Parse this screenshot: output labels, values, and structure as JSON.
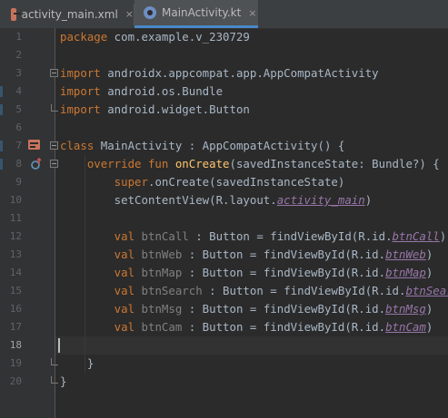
{
  "tabs": [
    {
      "label": "activity_main.xml",
      "icon": "xml-file-icon",
      "close": "×"
    },
    {
      "label": "MainActivity.kt",
      "icon": "kotlin-file-icon",
      "close": "×"
    }
  ],
  "line_numbers": [
    "1",
    "2",
    "3",
    "4",
    "5",
    "6",
    "7",
    "8",
    "9",
    "10",
    "11",
    "12",
    "13",
    "14",
    "15",
    "16",
    "17",
    "18",
    "19",
    "20"
  ],
  "code": {
    "l1_kw": "package",
    "l1_rest": " com.example.v_230729",
    "l3_kw": "import",
    "l3_rest": " androidx.appcompat.app.AppCompatActivity",
    "l4_kw": "import",
    "l4_rest": " android.os.Bundle",
    "l5_kw": "import",
    "l5_rest": " android.widget.Button",
    "l7_kw": "class",
    "l7_rest": " MainActivity : AppCompatActivity() {",
    "l8_kw": "    override fun ",
    "l8_fn": "onCreate",
    "l8_rest": "(savedInstanceState: Bundle?) {",
    "l9_kw": "        super",
    "l9_rest": ".onCreate(savedInstanceState)",
    "l10_pre": "        setContentView(R.layout.",
    "l10_prop": "activity_main",
    "l10_post": ")",
    "vals": [
      {
        "name": "btnCall",
        "pad": " : Button = findViewById(R.id.",
        "ref": "btnCall",
        "post": ")"
      },
      {
        "name": "btnWeb",
        "pad": " : Button = findViewById(R.id.",
        "ref": "btnWeb",
        "post": ")"
      },
      {
        "name": "btnMap",
        "pad": " : Button = findViewById(R.id.",
        "ref": "btnMap",
        "post": ")"
      },
      {
        "name": "btnSearch",
        "pad": " : Button = findViewById(R.id.",
        "ref": "btnSearch",
        "post": ")"
      },
      {
        "name": "btnMsg",
        "pad": " : Button = findViewById(R.id.",
        "ref": "btnMsg",
        "post": ")"
      },
      {
        "name": "btnCam",
        "pad": " : Button = findViewById(R.id.",
        "ref": "btnCam",
        "post": ")"
      }
    ],
    "val_kw": "        val ",
    "l19": "    }",
    "l20": "}"
  },
  "colors": {
    "keyword": "#cc7832",
    "function": "#ffc66d",
    "property": "#9876aa",
    "text": "#a9b7c6",
    "unused": "#808080",
    "change_marker_modified": "#385570",
    "change_marker_added": "#384c38"
  }
}
